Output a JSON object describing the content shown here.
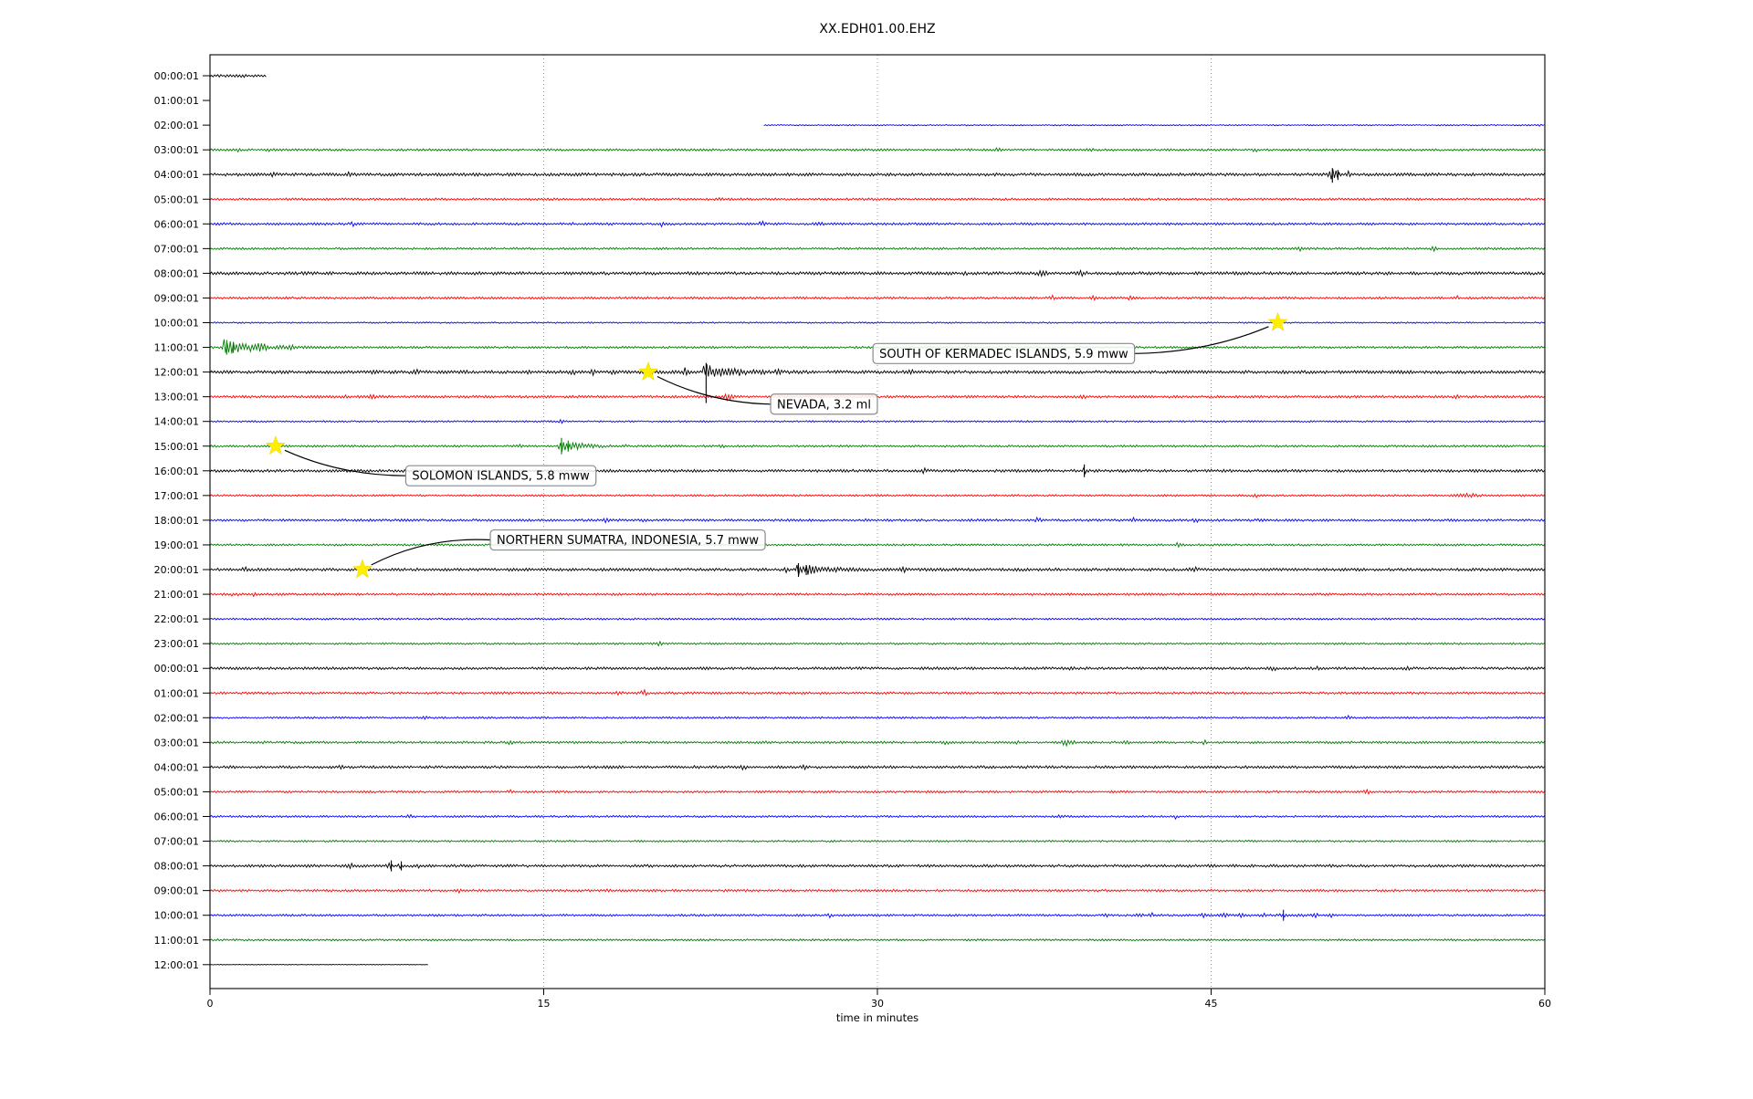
{
  "chart_data": {
    "type": "line",
    "title": "XX.EDH01.00.EHZ",
    "xlabel": "time in minutes",
    "x_ticks": [
      0,
      15,
      30,
      45,
      60
    ],
    "xlim_minutes": [
      0,
      60
    ],
    "grid": {
      "vertical_minutes": [
        15,
        30,
        45
      ],
      "style": "dotted-gray"
    },
    "palette": {
      "k": "#000000",
      "r": "#ff0000",
      "b": "#0000ff",
      "g": "#007c00"
    },
    "trace_color_cycle": [
      "k",
      "r",
      "b",
      "g"
    ],
    "rows": [
      {
        "label": "00:00:01",
        "color": "k",
        "segments": [
          [
            0,
            2.55
          ]
        ],
        "noise": 1.5,
        "bursts": [
          {
            "m": 1.15,
            "a": 2.2,
            "w": 0.1
          },
          {
            "m": 1.55,
            "a": 2.2,
            "w": 0.1
          }
        ],
        "spikes": []
      },
      {
        "label": "01:00:01",
        "color": "r",
        "segments": [],
        "noise": 0,
        "bursts": [],
        "spikes": []
      },
      {
        "label": "02:00:01",
        "color": "b",
        "segments": [
          [
            24.9,
            60
          ]
        ],
        "noise": 0.7,
        "bursts": [
          {
            "m": 59.8,
            "a": 1.6,
            "w": 0.07
          }
        ],
        "spikes": []
      },
      {
        "label": "03:00:01",
        "color": "g",
        "segments": [
          [
            0,
            60
          ]
        ],
        "noise": 1.2,
        "bursts": [
          {
            "m": 1.2,
            "a": 1.6
          },
          {
            "m": 2.7,
            "a": 1.6
          },
          {
            "m": 35.4,
            "a": 1.5
          },
          {
            "m": 39.6,
            "a": 2
          },
          {
            "m": 47,
            "a": 1.5
          }
        ],
        "spikes": []
      },
      {
        "label": "04:00:01",
        "color": "k",
        "segments": [
          [
            0,
            60
          ]
        ],
        "noise": 1.7,
        "bursts": [
          {
            "m": 2.9,
            "a": 2
          },
          {
            "m": 6.2,
            "a": 1.5
          },
          {
            "m": 26,
            "a": 1.5
          },
          {
            "m": 50.5,
            "a": 4.5,
            "w": 0.22
          },
          {
            "m": 51.2,
            "a": 2.5
          }
        ],
        "spikes": [
          {
            "m": 50.45,
            "u": 7,
            "dn": 9
          },
          {
            "m": 50.7,
            "u": 5,
            "dn": 6
          }
        ]
      },
      {
        "label": "05:00:01",
        "color": "r",
        "segments": [
          [
            0,
            60
          ]
        ],
        "noise": 1.25,
        "bursts": [
          {
            "m": 22.9,
            "a": 1.3
          }
        ],
        "spikes": []
      },
      {
        "label": "06:00:01",
        "color": "b",
        "segments": [
          [
            0,
            60
          ]
        ],
        "noise": 1.3,
        "bursts": [
          {
            "m": 6.4,
            "a": 1.6
          },
          {
            "m": 16.2,
            "a": 1.8
          },
          {
            "m": 20.3,
            "a": 2.2
          },
          {
            "m": 24.8,
            "a": 2
          },
          {
            "m": 27.4,
            "a": 1.7
          }
        ],
        "spikes": []
      },
      {
        "label": "07:00:01",
        "color": "g",
        "segments": [
          [
            0,
            60
          ]
        ],
        "noise": 1.2,
        "bursts": [
          {
            "m": 49,
            "a": 2
          },
          {
            "m": 55,
            "a": 1.8
          }
        ],
        "spikes": []
      },
      {
        "label": "08:00:01",
        "color": "k",
        "segments": [
          [
            0,
            60
          ]
        ],
        "noise": 1.7,
        "bursts": [
          {
            "m": 33.9,
            "a": 1.8
          },
          {
            "m": 37.4,
            "a": 2.6,
            "w": 0.18
          },
          {
            "m": 39.2,
            "a": 2,
            "w": 0.15
          }
        ],
        "spikes": []
      },
      {
        "label": "09:00:01",
        "color": "r",
        "segments": [
          [
            0,
            60
          ]
        ],
        "noise": 1.3,
        "bursts": [
          {
            "m": 37.9,
            "a": 1.8
          },
          {
            "m": 39.7,
            "a": 2.4
          },
          {
            "m": 41.4,
            "a": 2.4
          },
          {
            "m": 56.1,
            "a": 1.6
          }
        ],
        "spikes": []
      },
      {
        "label": "10:00:01",
        "color": "b",
        "segments": [
          [
            0,
            60
          ]
        ],
        "noise": 0.85,
        "bursts": [],
        "spikes": []
      },
      {
        "label": "11:00:01",
        "color": "g",
        "segments": [
          [
            0,
            60
          ]
        ],
        "noise": 1.2,
        "bursts": [
          {
            "m": 0.62,
            "a": 8,
            "d": 1.1
          },
          {
            "m": 2.2,
            "a": 2.5,
            "w": 0.35
          },
          {
            "m": 3.6,
            "a": 1.5,
            "w": 0.3
          },
          {
            "m": 34,
            "a": 1.3
          }
        ],
        "spikes": [
          {
            "m": 0.75,
            "u": 8,
            "dn": 8
          },
          {
            "m": 1.05,
            "u": 6,
            "dn": 6
          }
        ]
      },
      {
        "label": "12:00:01",
        "color": "k",
        "segments": [
          [
            0,
            60
          ]
        ],
        "noise": 1.7,
        "bursts": [
          {
            "m": 7.4,
            "a": 1.5
          },
          {
            "m": 9.3,
            "a": 1.8
          },
          {
            "m": 11.4,
            "a": 1.4
          },
          {
            "m": 14.3,
            "a": 1.5
          },
          {
            "m": 16.3,
            "a": 2
          },
          {
            "m": 17.2,
            "a": 2
          },
          {
            "m": 18.1,
            "a": 1.6
          },
          {
            "m": 21.4,
            "a": 4,
            "w": 0.12
          },
          {
            "m": 22.2,
            "a": 8,
            "d": 1.2
          },
          {
            "m": 23.8,
            "a": 2.4
          },
          {
            "m": 25.5,
            "a": 2
          },
          {
            "m": 31.5,
            "a": 1.4
          },
          {
            "m": 44,
            "a": 1.4
          }
        ],
        "spikes": [
          {
            "m": 22.3,
            "u": 10,
            "dn": 34
          }
        ]
      },
      {
        "label": "13:00:01",
        "color": "r",
        "segments": [
          [
            0,
            60
          ]
        ],
        "noise": 1.4,
        "bursts": [
          {
            "m": 6,
            "a": 1.5
          },
          {
            "m": 7.3,
            "a": 2
          },
          {
            "m": 7.8,
            "a": 2
          },
          {
            "m": 23.3,
            "a": 3,
            "w": 0.2
          },
          {
            "m": 39.3,
            "a": 1.6
          },
          {
            "m": 56,
            "a": 1.3
          }
        ],
        "spikes": []
      },
      {
        "label": "14:00:01",
        "color": "b",
        "segments": [
          [
            0,
            60
          ]
        ],
        "noise": 0.95,
        "bursts": [
          {
            "m": 15.8,
            "a": 1.2
          }
        ],
        "spikes": []
      },
      {
        "label": "15:00:01",
        "color": "g",
        "segments": [
          [
            0,
            60
          ]
        ],
        "noise": 1.2,
        "bursts": [
          {
            "m": 13.9,
            "a": 1.4
          },
          {
            "m": 15.7,
            "a": 7,
            "d": 0.85
          },
          {
            "m": 18.6,
            "a": 1.5
          },
          {
            "m": 23,
            "a": 1.1
          }
        ],
        "spikes": [
          {
            "m": 15.8,
            "u": 9,
            "dn": 9
          },
          {
            "m": 16.1,
            "u": 6,
            "dn": 6
          }
        ]
      },
      {
        "label": "16:00:01",
        "color": "k",
        "segments": [
          [
            0,
            60
          ]
        ],
        "noise": 1.55,
        "bursts": [
          {
            "m": 32.1,
            "a": 1.8
          },
          {
            "m": 39.3,
            "a": 2,
            "w": 0.15
          }
        ],
        "spikes": [
          {
            "m": 39.3,
            "u": 7,
            "dn": 7
          }
        ]
      },
      {
        "label": "17:00:01",
        "color": "r",
        "segments": [
          [
            0,
            60
          ]
        ],
        "noise": 1.05,
        "bursts": [
          {
            "m": 47,
            "a": 1.3
          },
          {
            "m": 56.5,
            "a": 1.5,
            "w": 0.5
          }
        ],
        "spikes": []
      },
      {
        "label": "18:00:01",
        "color": "b",
        "segments": [
          [
            0,
            60
          ]
        ],
        "noise": 1.3,
        "bursts": [
          {
            "m": 17.8,
            "a": 2
          },
          {
            "m": 19.5,
            "a": 1.6
          },
          {
            "m": 29.6,
            "a": 1.5
          },
          {
            "m": 37.2,
            "a": 2
          },
          {
            "m": 41.5,
            "a": 2.2
          },
          {
            "m": 44.3,
            "a": 1.7
          },
          {
            "m": 47.2,
            "a": 1.6
          }
        ],
        "spikes": []
      },
      {
        "label": "19:00:01",
        "color": "g",
        "segments": [
          [
            0,
            60
          ]
        ],
        "noise": 1.15,
        "bursts": [
          {
            "m": 43.5,
            "a": 2
          }
        ],
        "spikes": []
      },
      {
        "label": "20:00:01",
        "color": "k",
        "segments": [
          [
            0,
            60
          ]
        ],
        "noise": 1.6,
        "bursts": [
          {
            "m": 1.6,
            "a": 1.5
          },
          {
            "m": 25.85,
            "a": 3,
            "w": 0.12
          },
          {
            "m": 26.4,
            "a": 6.5,
            "d": 1.0
          },
          {
            "m": 31.2,
            "a": 1.6
          },
          {
            "m": 44.2,
            "a": 1.8,
            "w": 0.2
          }
        ],
        "spikes": [
          {
            "m": 26.45,
            "u": 7,
            "dn": 8
          },
          {
            "m": 26.8,
            "u": 5,
            "dn": 6
          }
        ]
      },
      {
        "label": "21:00:01",
        "color": "r",
        "segments": [
          [
            0,
            60
          ]
        ],
        "noise": 1.25,
        "bursts": [
          {
            "m": 1.1,
            "a": 2
          },
          {
            "m": 2,
            "a": 1.6
          }
        ],
        "spikes": []
      },
      {
        "label": "22:00:01",
        "color": "b",
        "segments": [
          [
            0,
            60
          ]
        ],
        "noise": 1.05,
        "bursts": [],
        "spikes": []
      },
      {
        "label": "23:00:01",
        "color": "g",
        "segments": [
          [
            0,
            60
          ]
        ],
        "noise": 1.1,
        "bursts": [
          {
            "m": 20.2,
            "a": 1.4
          }
        ],
        "spikes": []
      },
      {
        "label": "00:00:01",
        "color": "k",
        "segments": [
          [
            0,
            60
          ]
        ],
        "noise": 1.45,
        "bursts": [
          {
            "m": 38.7,
            "a": 1.4
          },
          {
            "m": 47.8,
            "a": 1.6
          },
          {
            "m": 49.8,
            "a": 1.6
          },
          {
            "m": 53.8,
            "a": 1.8
          }
        ],
        "spikes": []
      },
      {
        "label": "01:00:01",
        "color": "r",
        "segments": [
          [
            0,
            60
          ]
        ],
        "noise": 1.3,
        "bursts": [
          {
            "m": 13.5,
            "a": 2
          },
          {
            "m": 18.4,
            "a": 2
          },
          {
            "m": 19.5,
            "a": 2.4
          }
        ],
        "spikes": []
      },
      {
        "label": "02:00:01",
        "color": "b",
        "segments": [
          [
            0,
            60
          ]
        ],
        "noise": 1.05,
        "bursts": [
          {
            "m": 9.7,
            "a": 1.4
          },
          {
            "m": 51.2,
            "a": 1.5
          }
        ],
        "spikes": []
      },
      {
        "label": "03:00:01",
        "color": "g",
        "segments": [
          [
            0,
            60
          ]
        ],
        "noise": 1.3,
        "bursts": [
          {
            "m": 2.4,
            "a": 1.4
          },
          {
            "m": 13.5,
            "a": 1.5
          },
          {
            "m": 18.5,
            "a": 1.5
          },
          {
            "m": 25,
            "a": 1.8
          },
          {
            "m": 33.1,
            "a": 1.6
          },
          {
            "m": 36.3,
            "a": 1.8
          },
          {
            "m": 38.5,
            "a": 2.4,
            "w": 0.3
          },
          {
            "m": 41.2,
            "a": 1.6
          },
          {
            "m": 44.7,
            "a": 1.5
          }
        ],
        "spikes": []
      },
      {
        "label": "04:00:01",
        "color": "k",
        "segments": [
          [
            0,
            60
          ]
        ],
        "noise": 1.5,
        "bursts": [
          {
            "m": 5.9,
            "a": 1.5
          },
          {
            "m": 21.8,
            "a": 1.6
          },
          {
            "m": 24,
            "a": 1.9
          },
          {
            "m": 26.7,
            "a": 1.6
          }
        ],
        "spikes": []
      },
      {
        "label": "05:00:01",
        "color": "r",
        "segments": [
          [
            0,
            60
          ]
        ],
        "noise": 1.2,
        "bursts": [
          {
            "m": 13.5,
            "a": 1.4
          },
          {
            "m": 52,
            "a": 1.9
          }
        ],
        "spikes": []
      },
      {
        "label": "06:00:01",
        "color": "b",
        "segments": [
          [
            0,
            60
          ]
        ],
        "noise": 1.15,
        "bursts": [
          {
            "m": 9,
            "a": 1.5
          },
          {
            "m": 38.2,
            "a": 1.6
          },
          {
            "m": 43.4,
            "a": 1.6
          }
        ],
        "spikes": []
      },
      {
        "label": "07:00:01",
        "color": "g",
        "segments": [
          [
            0,
            60
          ]
        ],
        "noise": 1.1,
        "bursts": [],
        "spikes": []
      },
      {
        "label": "08:00:01",
        "color": "k",
        "segments": [
          [
            0,
            60
          ]
        ],
        "noise": 1.5,
        "bursts": [
          {
            "m": 4.6,
            "a": 1.5
          },
          {
            "m": 6.3,
            "a": 1.8
          },
          {
            "m": 8.1,
            "a": 2.2
          },
          {
            "m": 8.6,
            "a": 2.2
          },
          {
            "m": 9.3,
            "a": 1.8
          }
        ],
        "spikes": [
          {
            "m": 8.15,
            "u": 6,
            "dn": 6
          },
          {
            "m": 8.6,
            "u": 5,
            "dn": 5
          }
        ]
      },
      {
        "label": "09:00:01",
        "color": "r",
        "segments": [
          [
            0,
            60
          ]
        ],
        "noise": 1.25,
        "bursts": [
          {
            "m": 11.2,
            "a": 1.3
          },
          {
            "m": 17.8,
            "a": 1.4
          }
        ],
        "spikes": []
      },
      {
        "label": "10:00:01",
        "color": "b",
        "segments": [
          [
            0,
            60
          ]
        ],
        "noise": 1.2,
        "bursts": [
          {
            "m": 27.9,
            "a": 1.7
          },
          {
            "m": 40.3,
            "a": 2
          },
          {
            "m": 41.8,
            "a": 2
          },
          {
            "m": 42.3,
            "a": 1.8
          },
          {
            "m": 44.7,
            "a": 2
          },
          {
            "m": 45.6,
            "a": 2.2
          },
          {
            "m": 46.4,
            "a": 2
          },
          {
            "m": 47.4,
            "a": 2.4
          },
          {
            "m": 48.2,
            "a": 2.2
          },
          {
            "m": 49,
            "a": 1.9
          },
          {
            "m": 49.7,
            "a": 1.9
          },
          {
            "m": 50.4,
            "a": 2.2
          }
        ],
        "spikes": [
          {
            "m": 48.25,
            "u": 6,
            "dn": 6
          }
        ]
      },
      {
        "label": "11:00:01",
        "color": "g",
        "segments": [
          [
            0,
            60
          ]
        ],
        "noise": 1.05,
        "bursts": [],
        "spikes": []
      },
      {
        "label": "12:00:01",
        "color": "k",
        "segments": [
          [
            0,
            9.85
          ]
        ],
        "noise": 0.35,
        "bursts": [],
        "spikes": []
      }
    ],
    "events": [
      {
        "label": "SOUTH OF KERMADEC ISLANDS, 5.9 mww",
        "star_row": 10,
        "star_minute": 48.0,
        "box_row": 11.25,
        "box_minute": 29.8
      },
      {
        "label": "NEVADA, 3.2 ml",
        "star_row": 12,
        "star_minute": 19.7,
        "box_row": 13.3,
        "box_minute": 25.2
      },
      {
        "label": "SOLOMON ISLANDS, 5.8 mww",
        "star_row": 15,
        "star_minute": 2.95,
        "box_row": 16.2,
        "box_minute": 8.8
      },
      {
        "label": "NORTHERN SUMATRA, INDONESIA, 5.7 mww",
        "star_row": 20,
        "star_minute": 6.85,
        "box_row": 18.8,
        "box_minute": 12.6
      }
    ],
    "marker_color": "#ffee00"
  }
}
